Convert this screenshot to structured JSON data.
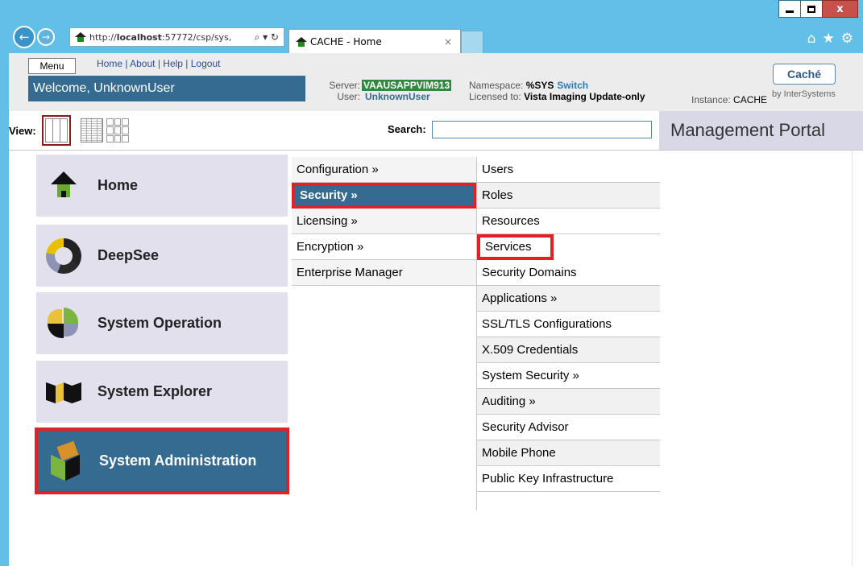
{
  "browser": {
    "url_plain": "http://",
    "url_bold": "localhost",
    "url_rest": ":57772/csp/sys,",
    "url_tools": "⌕ ▾ ↻",
    "tab_title": "CACHE - Home",
    "tab_close": "×",
    "back_glyph": "←",
    "forward_glyph": "→",
    "minimize": "",
    "maximize": "",
    "close": "x",
    "chrome_icons": [
      "⌂",
      "★",
      "⚙"
    ]
  },
  "header": {
    "menu_label": "Menu",
    "top_links": "Home | About | Help | Logout",
    "welcome": "Welcome, UnknownUser",
    "server_label": "Server:",
    "server_value": "VAAUSAPPVIM913",
    "user_label": "User:",
    "user_value": "UnknownUser",
    "namespace_label": "Namespace:",
    "namespace_value": "%SYS",
    "switch_label": "Switch",
    "licensed_label": "Licensed to:",
    "licensed_value": "Vista Imaging Update-only",
    "instance_label": "Instance:",
    "instance_value": "CACHE",
    "cache_button": "Caché",
    "by": "by InterSystems"
  },
  "viewbar": {
    "view_label": "View:",
    "search_label": "Search:",
    "search_value": "",
    "portal_title": "Management Portal"
  },
  "tiles": [
    {
      "label": "Home",
      "icon": "home-icon"
    },
    {
      "label": "DeepSee",
      "icon": "deepsee-icon"
    },
    {
      "label": "System Operation",
      "icon": "system-operation-icon"
    },
    {
      "label": "System Explorer",
      "icon": "system-explorer-icon"
    },
    {
      "label": "System Administration",
      "icon": "system-administration-icon",
      "active": true
    }
  ],
  "menu_level1": [
    "Configuration »",
    "Security »",
    "Licensing »",
    "Encryption »",
    "Enterprise Manager"
  ],
  "menu_level2": [
    "Users",
    "Roles",
    "Resources",
    "Services",
    "Security Domains",
    "Applications »",
    "SSL/TLS Configurations",
    "X.509 Credentials",
    "System Security »",
    "Auditing »",
    "Security Advisor",
    "Mobile Phone",
    "Public Key Infrastructure"
  ],
  "colors": {
    "chrome": "#61bfe8",
    "accent_blue": "#356b91",
    "highlight_red": "#e32026",
    "server_green": "#2e8b3d"
  }
}
